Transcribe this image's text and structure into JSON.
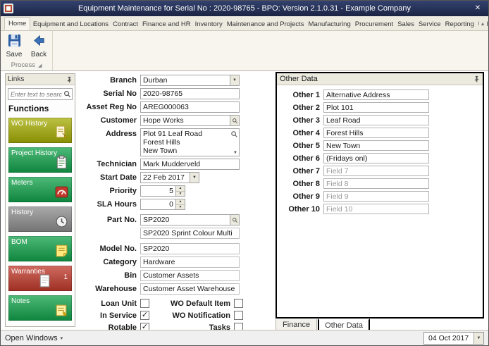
{
  "window": {
    "title": "Equipment Maintenance for Serial No : 2020-98765 - BPO: Version 2.1.0.31 - Example Company"
  },
  "icons": {
    "close": "✕",
    "dropdown": "▼",
    "up": "▲",
    "down": "▼",
    "collapse": "▴",
    "caret": "▾",
    "launcher": "◢"
  },
  "ribbon": {
    "tabs": [
      {
        "label": "Home"
      },
      {
        "label": "Equipment and Locations"
      },
      {
        "label": "Contract"
      },
      {
        "label": "Finance and HR"
      },
      {
        "label": "Inventory"
      },
      {
        "label": "Maintenance and Projects"
      },
      {
        "label": "Manufacturing"
      },
      {
        "label": "Procurement"
      },
      {
        "label": "Sales"
      },
      {
        "label": "Service"
      },
      {
        "label": "Reporting"
      },
      {
        "label": "Utilities"
      }
    ],
    "save_label": "Save",
    "back_label": "Back",
    "group_label": "Process"
  },
  "links": {
    "title": "Links",
    "search_placeholder": "Enter text to search...",
    "functions_title": "Functions",
    "items": [
      {
        "label": "WO History",
        "color": "#a6ad04"
      },
      {
        "label": "Project History",
        "color": "#12a24b"
      },
      {
        "label": "Meters",
        "color": "#12a24b"
      },
      {
        "label": "History",
        "color": "#8d8d8d"
      },
      {
        "label": "BOM",
        "color": "#12a24b"
      },
      {
        "label": "Warranties",
        "color": "#c0392b",
        "count": "1"
      },
      {
        "label": "Notes",
        "color": "#12a24b"
      }
    ]
  },
  "form": {
    "branch": {
      "label": "Branch",
      "value": "Durban"
    },
    "serial_no": {
      "label": "Serial No",
      "value": "2020-98765"
    },
    "asset_reg_no": {
      "label": "Asset Reg No",
      "value": "AREG000063"
    },
    "customer": {
      "label": "Customer",
      "value": "Hope Works"
    },
    "address": {
      "label": "Address",
      "line1": "Plot 91 Leaf Road",
      "line2": "Forest Hills",
      "line3": "New Town"
    },
    "technician": {
      "label": "Technician",
      "value": "Mark Mudderveld"
    },
    "start_date": {
      "label": "Start Date",
      "value": "22 Feb 2017"
    },
    "priority": {
      "label": "Priority",
      "value": "5"
    },
    "sla_hours": {
      "label": "SLA Hours",
      "value": "0"
    },
    "part_no": {
      "label": "Part No.",
      "value": "SP2020",
      "description": "SP2020 Sprint Colour Multi"
    },
    "model_no": {
      "label": "Model No.",
      "value": "SP2020"
    },
    "category": {
      "label": "Category",
      "value": "Hardware"
    },
    "bin": {
      "label": "Bin",
      "value": "Customer Assets"
    },
    "warehouse": {
      "label": "Warehouse",
      "value": "Customer Asset Warehouse"
    },
    "checks": {
      "loan_unit": {
        "label": "Loan Unit",
        "mark": ""
      },
      "wo_default_item": {
        "label": "WO Default Item",
        "mark": ""
      },
      "in_service": {
        "label": "In Service",
        "mark": "✓"
      },
      "wo_notification": {
        "label": "WO Notification",
        "mark": ""
      },
      "rotable": {
        "label": "Rotable",
        "mark": "✓"
      },
      "tasks": {
        "label": "Tasks",
        "mark": ""
      }
    }
  },
  "other_data": {
    "title": "Other Data",
    "fields": [
      {
        "label": "Other 1",
        "value": "Alternative Address"
      },
      {
        "label": "Other 2",
        "value": "Plot 101"
      },
      {
        "label": "Other 3",
        "value": "Leaf Road"
      },
      {
        "label": "Other 4",
        "value": "Forest Hills"
      },
      {
        "label": "Other 5",
        "value": "New Town"
      },
      {
        "label": "Other 6",
        "value": "(Fridays onl)"
      },
      {
        "label": "Other 7",
        "value": "Field 7"
      },
      {
        "label": "Other 8",
        "value": "Field 8"
      },
      {
        "label": "Other 9",
        "value": "Field 9"
      },
      {
        "label": "Other 10",
        "value": "Field 10"
      }
    ]
  },
  "bottom_tabs": [
    {
      "label": "Finance"
    },
    {
      "label": "Other Data"
    }
  ],
  "statusbar": {
    "open_windows_label": "Open Windows",
    "date_value": "04 Oct 2017"
  }
}
